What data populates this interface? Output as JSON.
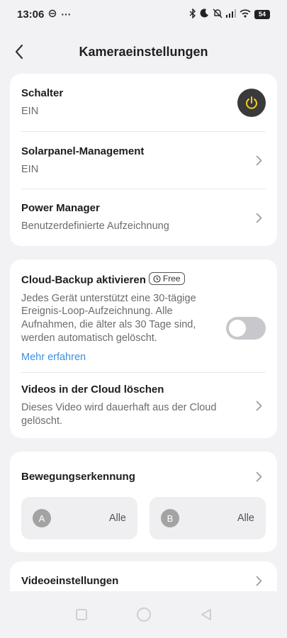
{
  "status_bar": {
    "time": "13:06",
    "battery": "54"
  },
  "header": {
    "title": "Kameraeinstellungen"
  },
  "card1": {
    "schalter": {
      "title": "Schalter",
      "value": "EIN"
    },
    "solar": {
      "title": "Solarpanel-Management",
      "value": "EIN"
    },
    "power": {
      "title": "Power Manager",
      "value": "Benutzerdefinierte Aufzeichnung"
    }
  },
  "card2": {
    "cloud": {
      "title": "Cloud-Backup aktivieren",
      "badge": "Free",
      "description": "Jedes Gerät unterstützt eine 30-tägige Ereignis-Loop-Aufzeichnung. Alle Aufnahmen, die älter als 30 Tage sind, werden automatisch gelöscht.",
      "link": "Mehr erfahren",
      "toggle_on": false
    },
    "delete": {
      "title": "Videos in der Cloud löschen",
      "description": "Dieses Video wird dauerhaft aus der Cloud gelöscht."
    }
  },
  "card3": {
    "title": "Bewegungserkennung",
    "zones": [
      {
        "badge": "A",
        "value": "Alle"
      },
      {
        "badge": "B",
        "value": "Alle"
      }
    ]
  },
  "card4": {
    "title": "Videoeinstellungen"
  },
  "colors": {
    "accent_yellow": "#f5d020",
    "link_blue": "#3d8ee0",
    "background": "#f2f2f4"
  },
  "icons": [
    "back-arrow-icon",
    "power-icon",
    "chevron-right-icon",
    "clock-icon"
  ]
}
